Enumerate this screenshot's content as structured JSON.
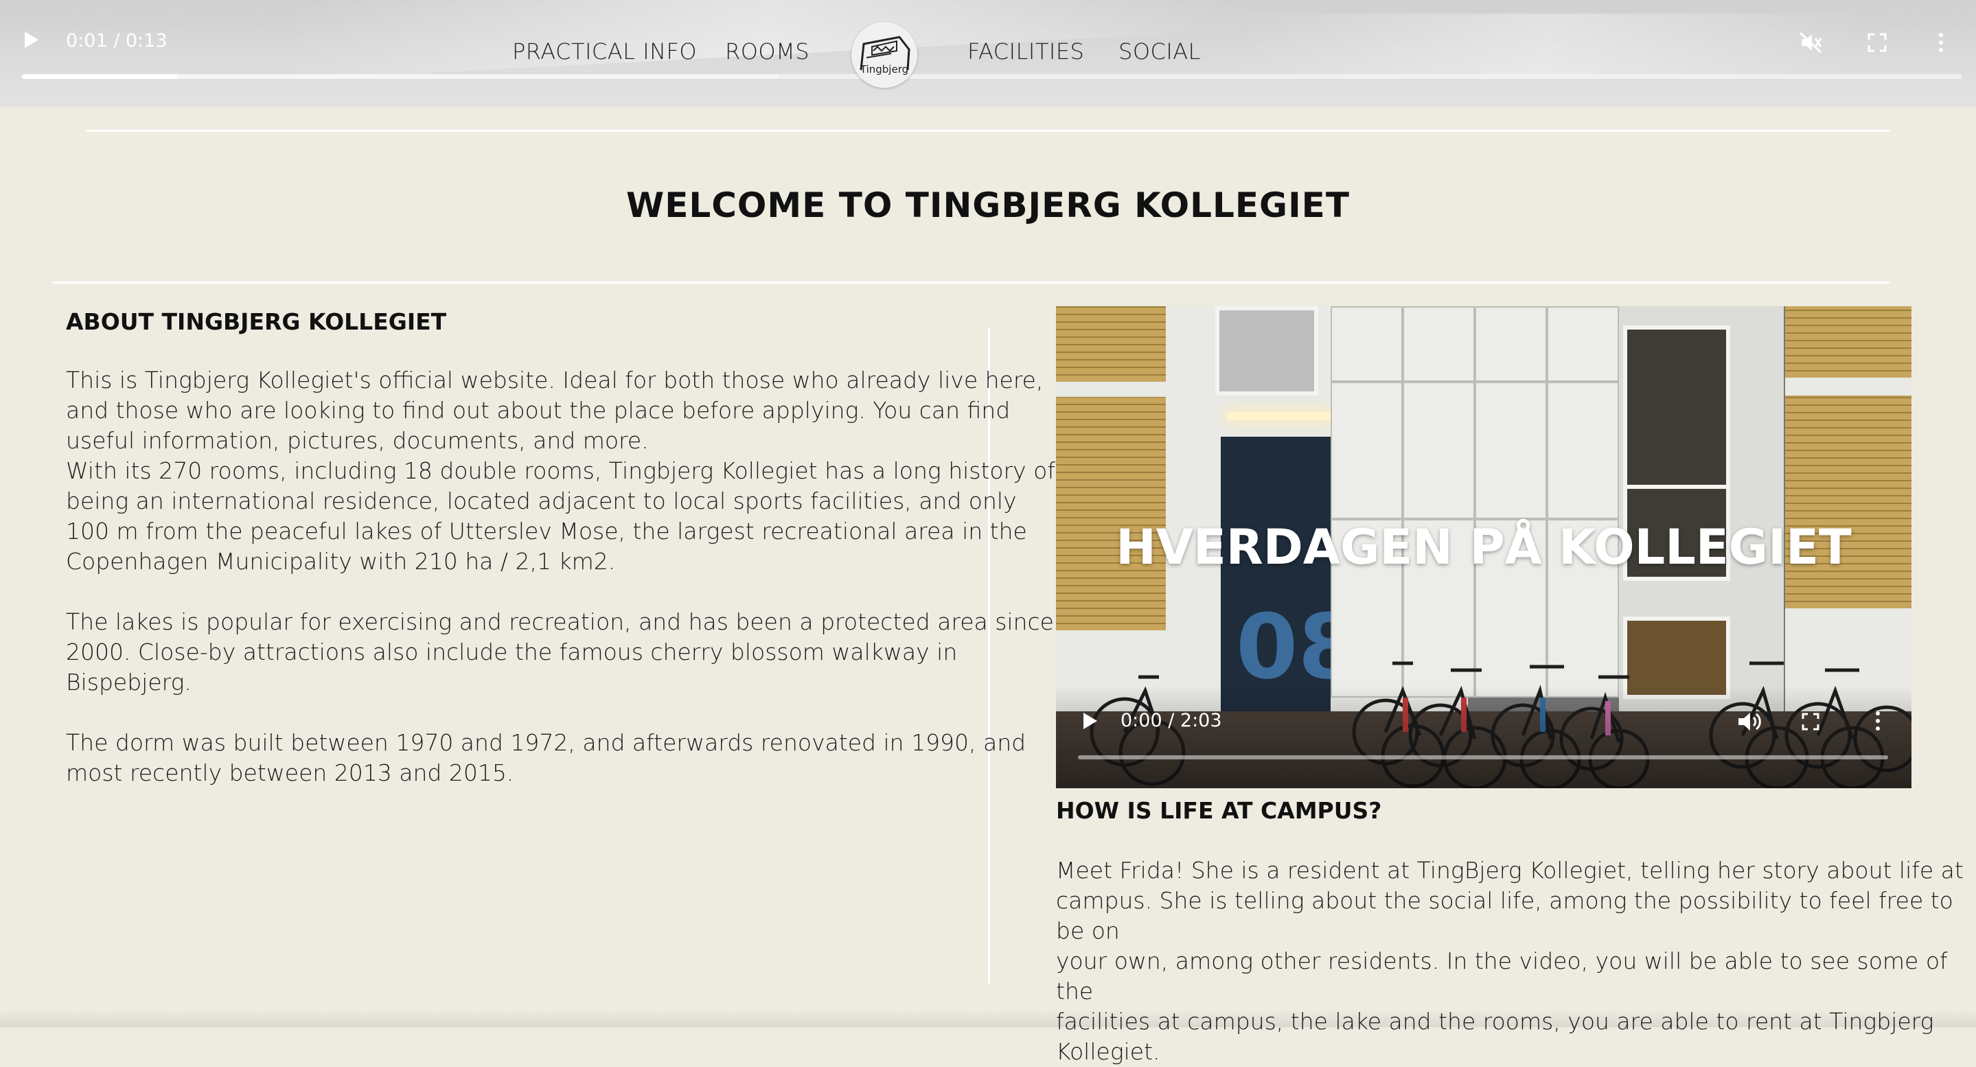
{
  "hero_video": {
    "time": "0:01 / 0:13",
    "progress": 0.08,
    "buffered": 0.39,
    "icons": [
      "play-icon",
      "mute-icon",
      "fullscreen-icon",
      "more-options-icon"
    ]
  },
  "nav": {
    "items": [
      {
        "label": "PRACTICAL INFO"
      },
      {
        "label": "ROOMS"
      },
      {
        "label": "FACILITIES"
      },
      {
        "label": "SOCIAL"
      }
    ],
    "logo_text": "Tingbjerg"
  },
  "page_title": "WELCOME TO TINGBJERG KOLLEGIET",
  "about": {
    "heading": "ABOUT TINGBJERG KOLLEGIET",
    "p1_lines": [
      "This is Tingbjerg Kollegiet's official website. Ideal for both those who already live here,",
      "and those who are looking to find out about the place before applying. You can find",
      "useful information, pictures, documents, and more.",
      "With its 270 rooms, including 18 double rooms, Tingbjerg Kollegiet has a long history of",
      "being an international residence, located adjacent to local sports facilities, and only",
      "100 m from the peaceful lakes of Utterslev Mose, the largest recreational area in the",
      "Copenhagen Municipality with 210 ha / 2,1 km2."
    ],
    "p2_lines": [
      "The lakes is popular for exercising and recreation, and has been a protected area since",
      "2000. Close-by attractions also include the famous cherry blossom walkway in",
      "Bispebjerg."
    ],
    "p3_lines": [
      "The dorm was built between 1970 and 1972, and afterwards renovated in 1990, and",
      "most recently between 2013 and 2015."
    ]
  },
  "video": {
    "title_overlay": "HVERDAGEN PÅ KOLLEGIET",
    "door_number": "08",
    "time": "0:00 / 2:03"
  },
  "campus": {
    "heading": "HOW IS LIFE AT CAMPUS?",
    "p_lines": [
      "Meet Frida! She is a resident at TingBjerg Kollegiet, telling her story about life at",
      "campus. She is telling about the social life, among the possibility to feel free to be on",
      "your own, among other residents. In the video, you will be able to see some of the",
      "facilities at campus, the lake and the rooms, you are able to rent at Tingbjerg Kollegiet."
    ]
  }
}
